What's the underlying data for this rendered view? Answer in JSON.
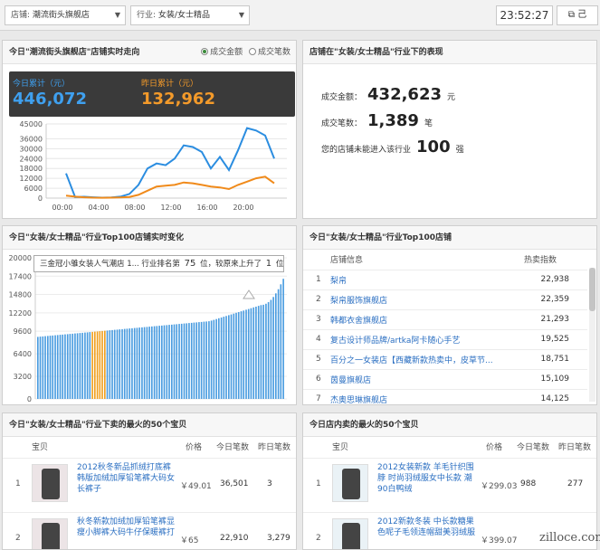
{
  "topbar": {
    "store_label": "店铺:",
    "store_value": "潮流街头旗舰店",
    "industry_label": "行业:",
    "industry_value": "女装/女士精品",
    "clock": "23:52:27",
    "ext_icon": "external-link-icon",
    "ext_label": "己"
  },
  "realtime": {
    "title": "今日\"潮流街头旗舰店\"店铺实时走向",
    "radio_amount": "成交金额",
    "radio_count": "成交笔数",
    "today_label": "今日累计（元）",
    "today_value": "446,072",
    "yesterday_label": "昨日累计（元）",
    "yesterday_value": "132,962",
    "colors": {
      "today": "#2b8de0",
      "yesterday": "#f08a1a"
    }
  },
  "industry_perf": {
    "title": "店铺在\"女装/女士精品\"行业下的表现",
    "amount_label": "成交金额：",
    "amount_value": "432,623",
    "amount_unit": "元",
    "count_label": "成交笔数：",
    "count_value": "1,389",
    "count_unit": "笔",
    "rank_label": "您的店铺未能进入该行业",
    "rank_value": "100",
    "rank_unit": "强"
  },
  "top100_change": {
    "title": "今日\"女装/女士精品\"行业Top100店铺实时变化",
    "tooltip_shop": "三金冠小雏女装人气潮店 1...",
    "tooltip_rank_pre": "行业排名第",
    "tooltip_rank": "75",
    "tooltip_rank_mid": "位，较原来上升了",
    "tooltip_up": "1",
    "tooltip_rank_post": "位"
  },
  "top100_list": {
    "title": "今日\"女装/女士精品\"行业Top100店铺",
    "col_shop": "店铺信息",
    "col_index": "热卖指数",
    "rows": [
      {
        "rank": "1",
        "name": "梨帛",
        "index": "22,938"
      },
      {
        "rank": "2",
        "name": "梨帛服饰旗舰店",
        "index": "22,359"
      },
      {
        "rank": "3",
        "name": "韩都衣舍旗舰店",
        "index": "21,293"
      },
      {
        "rank": "4",
        "name": "复古设计师品牌/artka阿卡随心手艺",
        "index": "19,525"
      },
      {
        "rank": "5",
        "name": "百分之一女装店【西藏新款热卖中，皮草节...",
        "index": "18,751"
      },
      {
        "rank": "6",
        "name": "茵曼旗舰店",
        "index": "15,109"
      },
      {
        "rank": "7",
        "name": "杰奥思琳旗舰店",
        "index": "14,125"
      }
    ]
  },
  "industry_items": {
    "title": "今日\"女装/女士精品\"行业下卖的最火的50个宝贝",
    "col_item": "宝贝",
    "col_price": "价格",
    "col_today": "今日笔数",
    "col_yesterday": "昨日笔数",
    "rows": [
      {
        "rank": "1",
        "name": "2012秋冬新品抓绒打底裤韩版加绒加厚铅笔裤大码女长裤子",
        "price": "￥49.01",
        "today": "36,501",
        "yesterday": "3"
      },
      {
        "rank": "2",
        "name": "秋冬新款加绒加厚铅笔裤显瘦小脚裤大码牛仔保暖裤打",
        "price": "￥65",
        "today": "22,910",
        "yesterday": "3,279"
      }
    ]
  },
  "shop_items": {
    "title": "今日店内卖的最火的50个宝贝",
    "col_item": "宝贝",
    "col_price": "价格",
    "col_today": "今日笔数",
    "col_yesterday": "昨日笔数",
    "rows": [
      {
        "rank": "1",
        "name": "2012女装新款 羊毛针织围脖 时尚羽绒服女中长款 潮 90白鸭绒",
        "price": "￥299.03",
        "today": "988",
        "yesterday": "277"
      },
      {
        "rank": "2",
        "name": "2012新款冬装 中长款糖果色呢子毛领连帽甜美羽绒服",
        "price": "￥399.07",
        "today": "",
        "yesterday": ""
      }
    ]
  },
  "watermark": "zilloce.com",
  "chart_data": [
    {
      "type": "line",
      "x": [
        "00:00",
        "01:00",
        "02:00",
        "03:00",
        "04:00",
        "05:00",
        "06:00",
        "07:00",
        "08:00",
        "09:00",
        "10:00",
        "11:00",
        "12:00",
        "13:00",
        "14:00",
        "15:00",
        "16:00",
        "17:00",
        "18:00",
        "19:00",
        "20:00",
        "21:00",
        "22:00"
      ],
      "xticks": [
        "00:00",
        "04:00",
        "08:00",
        "12:00",
        "16:00",
        "20:00"
      ],
      "yticks": [
        "0",
        "6000",
        "12000",
        "18000",
        "24000",
        "30000",
        "36000",
        "45000"
      ],
      "ylim": [
        0,
        45000
      ],
      "series": [
        {
          "color": "#2b8de0",
          "values": [
            15000,
            600,
            800,
            500,
            300,
            400,
            900,
            2500,
            8000,
            18000,
            21000,
            20000,
            24000,
            32000,
            31000,
            28000,
            18000,
            25000,
            17000,
            29000,
            42500,
            41000,
            38000,
            24000
          ]
        },
        {
          "color": "#f08a1a",
          "values": [
            1500,
            900,
            500,
            300,
            200,
            250,
            400,
            700,
            2000,
            4500,
            7000,
            7500,
            8000,
            9500,
            9000,
            8000,
            7000,
            6500,
            5500,
            8000,
            10000,
            12000,
            13000,
            9000
          ]
        }
      ]
    },
    {
      "type": "bar",
      "yticks": [
        "0",
        "3200",
        "6400",
        "9600",
        "12200",
        "14800",
        "17400",
        "20000"
      ],
      "ylim": [
        0,
        20000
      ],
      "highlight_color": "#f0a020",
      "bar_color": "#4a9ce0",
      "values_rule": "100 shops ranked ascending"
    }
  ]
}
